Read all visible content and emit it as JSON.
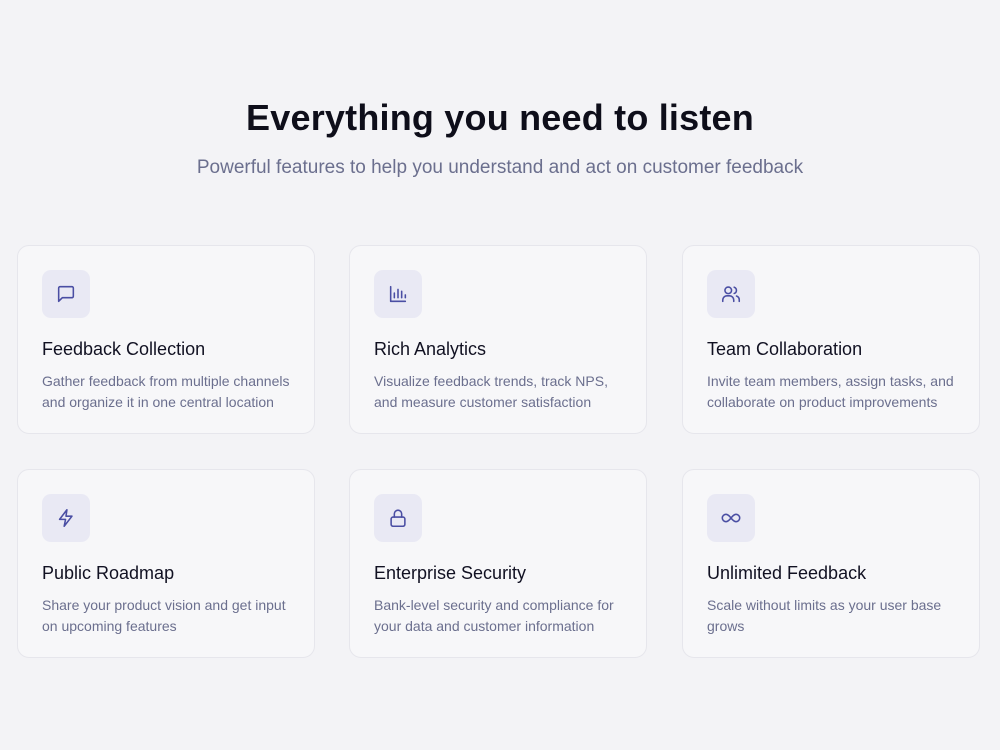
{
  "header": {
    "title": "Everything you need to listen",
    "subtitle": "Powerful features to help you understand and act on customer feedback"
  },
  "accent_color": "#4a4ea3",
  "features": [
    {
      "icon": "message-square-icon",
      "title": "Feedback Collection",
      "description": "Gather feedback from multiple channels and organize it in one central location"
    },
    {
      "icon": "bar-chart-icon",
      "title": "Rich Analytics",
      "description": "Visualize feedback trends, track NPS, and measure customer satisfaction"
    },
    {
      "icon": "users-icon",
      "title": "Team Collaboration",
      "description": "Invite team members, assign tasks, and collaborate on product improvements"
    },
    {
      "icon": "lightning-icon",
      "title": "Public Roadmap",
      "description": "Share your product vision and get input on upcoming features"
    },
    {
      "icon": "lock-icon",
      "title": "Enterprise Security",
      "description": "Bank-level security and compliance for your data and customer information"
    },
    {
      "icon": "infinity-icon",
      "title": "Unlimited Feedback",
      "description": "Scale without limits as your user base grows"
    }
  ]
}
